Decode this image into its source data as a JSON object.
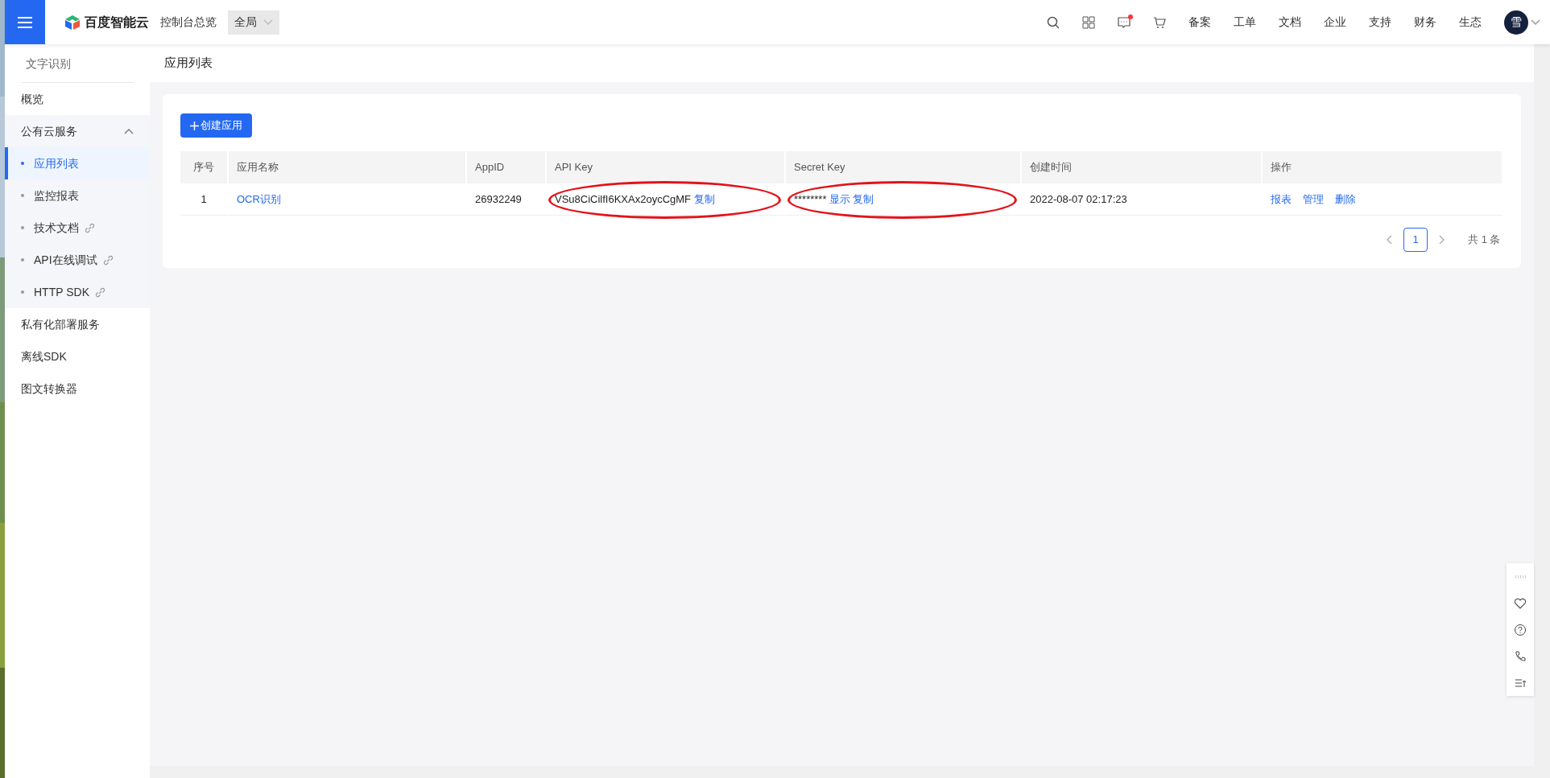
{
  "topbar": {
    "logo": "百度智能云",
    "console": "控制台总览",
    "region": "全局",
    "links": [
      "备案",
      "工单",
      "文档",
      "企业",
      "支持",
      "财务",
      "生态"
    ],
    "notification_dot": true,
    "avatar": "雪"
  },
  "sidebar": {
    "title": "文字识别",
    "items": [
      {
        "label": "概览"
      },
      {
        "label": "公有云服务",
        "expanded": true,
        "children": [
          {
            "label": "应用列表",
            "selected": true,
            "external": false
          },
          {
            "label": "监控报表",
            "selected": false,
            "external": false
          },
          {
            "label": "技术文档",
            "selected": false,
            "external": true
          },
          {
            "label": "API在线调试",
            "selected": false,
            "external": true
          },
          {
            "label": "HTTP SDK",
            "selected": false,
            "external": true
          }
        ]
      },
      {
        "label": "私有化部署服务"
      },
      {
        "label": "离线SDK"
      },
      {
        "label": "图文转换器"
      }
    ]
  },
  "page_title": "应用列表",
  "create_button": "创建应用",
  "table": {
    "columns": [
      "序号",
      "应用名称",
      "AppID",
      "API Key",
      "Secret Key",
      "创建时间",
      "操作"
    ],
    "rows": [
      {
        "index": "1",
        "name": "OCR识别",
        "app_id": "26932249",
        "api_key": {
          "value": "VSu8CiCilfI6KXAx2oycCgMF",
          "actions": [
            "复制"
          ],
          "highlighted": true
        },
        "secret_key": {
          "value": "********",
          "actions": [
            "显示",
            "复制"
          ],
          "highlighted": true
        },
        "created": "2022-08-07 02:17:23",
        "actions": [
          "报表",
          "管理",
          "删除"
        ]
      }
    ]
  },
  "pagination": {
    "pages": [
      {
        "label": "1",
        "selected": true
      }
    ],
    "total": "共 1 条"
  }
}
